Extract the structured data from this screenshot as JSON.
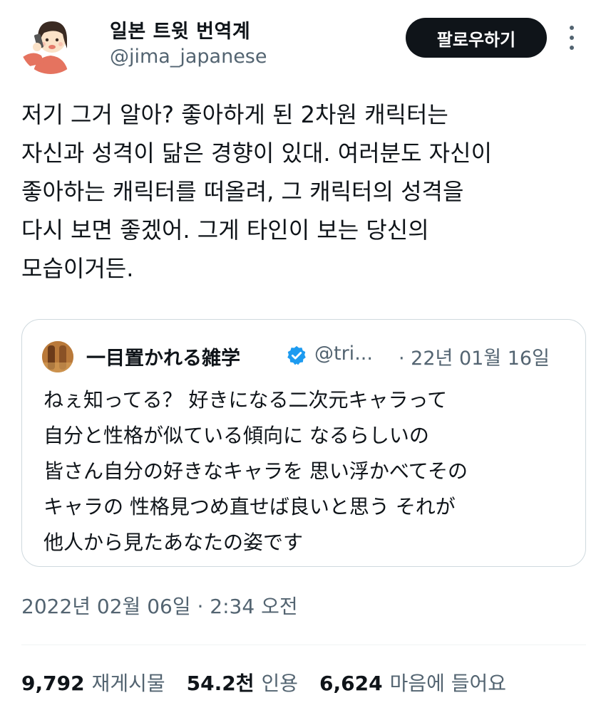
{
  "author": {
    "display_name": "일본 트윗 번역계",
    "handle": "@jima_japanese",
    "avatar_icon": "girl-phone-avatar-icon"
  },
  "actions": {
    "follow_label": "팔로우하기",
    "more_icon": "more-options-icon"
  },
  "tweet": {
    "lines": [
      "저기 그거 알아? 좋아하게 된 2차원 캐릭터는",
      "자신과 성격이 닮은 경향이 있대. 여러분도 자신이",
      "좋아하는 캐릭터를 떠올려, 그 캐릭터의 성격을",
      "다시 보면 좋겠어. 그게 타인이 보는 당신의",
      "모습이거든."
    ]
  },
  "quote": {
    "name": "一目置かれる雑学",
    "verified_icon": "verified-badge-icon",
    "handle": "@tri...",
    "date": "· 22년 01월 16일",
    "lines": [
      "ねぇ知ってる？ 好きになる二次元キャラって",
      "自分と性格が似ている傾向に なるらしいの",
      "皆さん自分の好きなキャラを 思い浮かべてその",
      "キャラの 性格見つめ直せば良いと思う それが",
      "他人から見たあなたの姿です"
    ]
  },
  "timestamp": "2022년 02월 06일 · 2:34 오전",
  "stats": {
    "retweets_count": "9,792",
    "retweets_label": "재게시물",
    "quotes_count": "54.2천",
    "quotes_label": "인용",
    "likes_count": "6,624",
    "likes_label": "마음에 들어요"
  },
  "colors": {
    "text": "#0f1419",
    "secondary": "#536471",
    "border": "#cfd9de",
    "verified": "#1d9bf0",
    "button_bg": "#0f1419"
  }
}
